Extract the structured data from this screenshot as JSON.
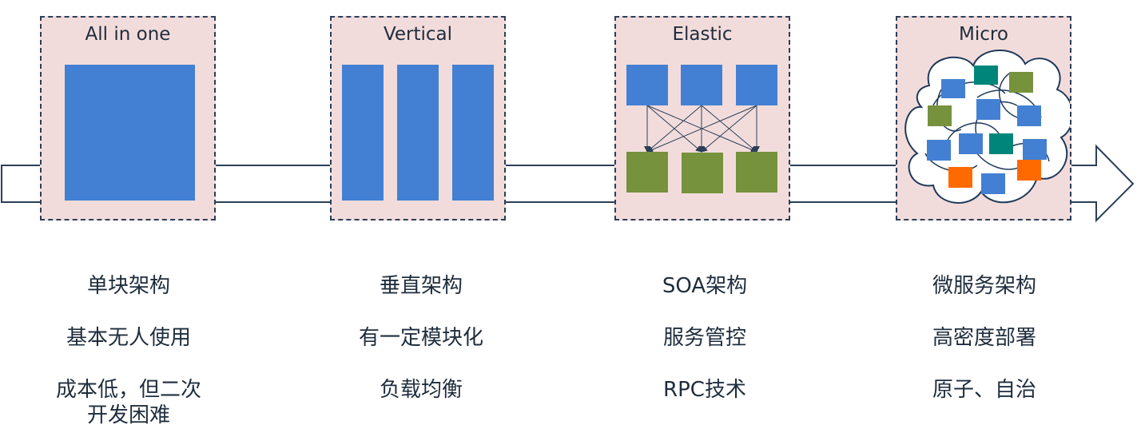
{
  "stages": [
    {
      "title": "All in one",
      "lines": [
        "单块架构",
        "基本无人使用",
        "成本低，但二次",
        "开发困难"
      ]
    },
    {
      "title": "Vertical",
      "lines": [
        "垂直架构",
        "有一定模块化",
        "负载均衡"
      ]
    },
    {
      "title": "Elastic",
      "lines": [
        "SOA架构",
        "服务管控",
        "RPC技术"
      ]
    },
    {
      "title": "Micro",
      "lines": [
        "微服务架构",
        "高密度部署",
        "原子、自治"
      ]
    }
  ],
  "colors": {
    "box_bg": "#f2dcdb",
    "blue": "#4380d3",
    "green": "#76923c",
    "teal": "#00857a",
    "orange": "#ff6a00",
    "border": "#2b3f58"
  }
}
